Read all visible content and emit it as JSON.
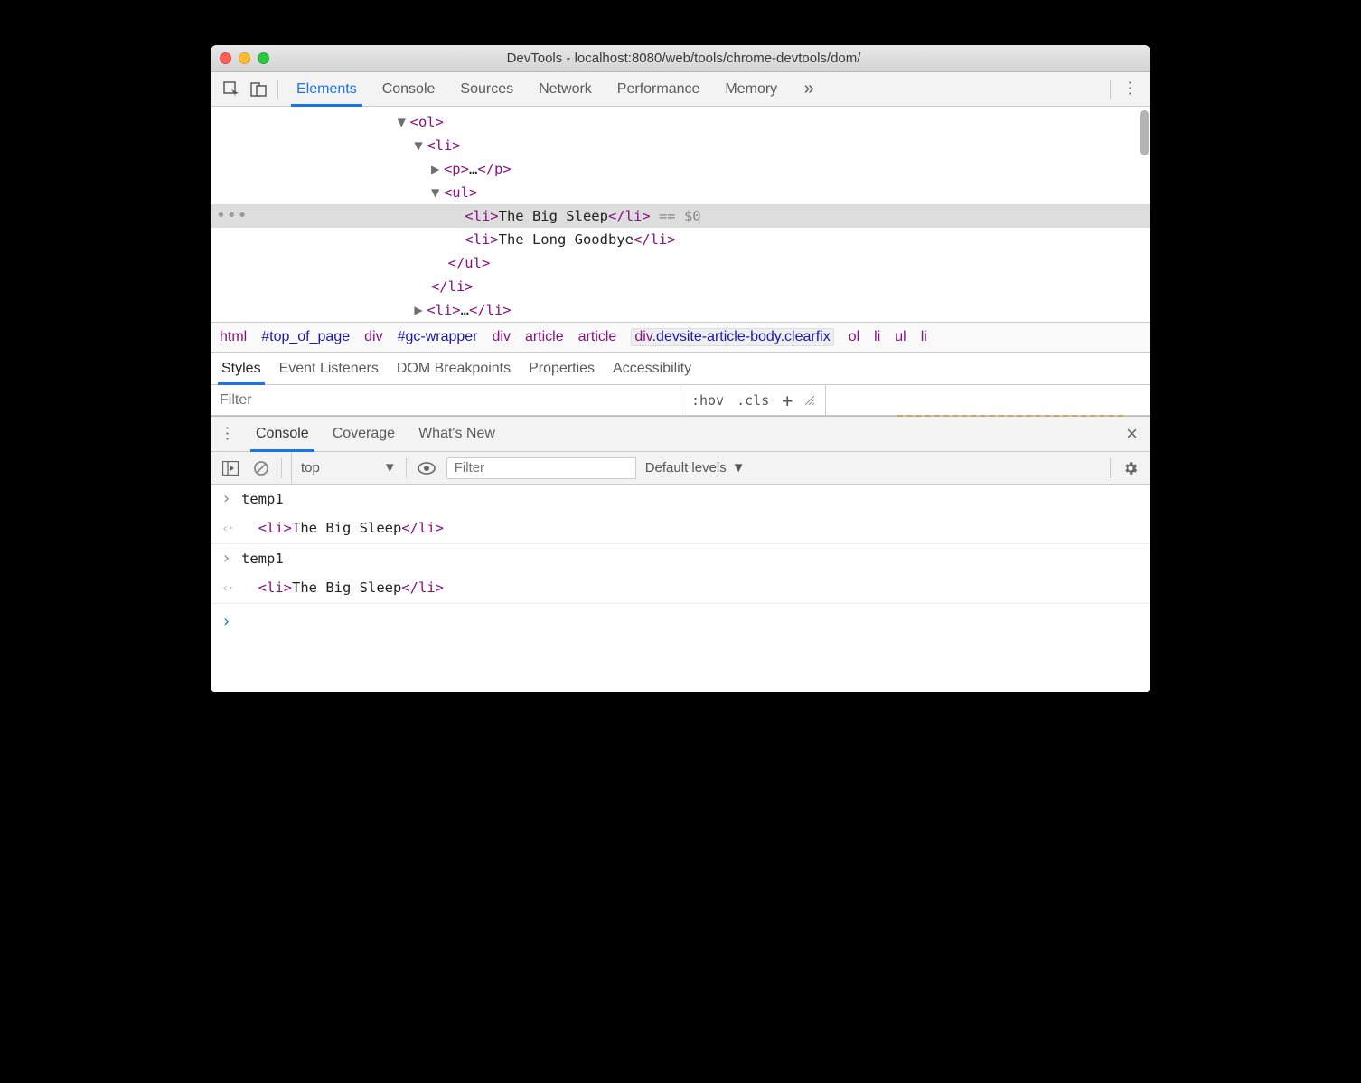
{
  "window": {
    "title": "DevTools - localhost:8080/web/tools/chrome-devtools/dom/"
  },
  "main_tabs": {
    "items": [
      "Elements",
      "Console",
      "Sources",
      "Network",
      "Performance",
      "Memory"
    ],
    "active": "Elements",
    "overflow_glyph": "»"
  },
  "dom": {
    "l0": "<ol>",
    "l1": "<li>",
    "l2_open": "<p>",
    "l2_ellipsis": "…",
    "l2_close": "</p>",
    "l3": "<ul>",
    "sel_open": "<li>",
    "sel_text": "The Big Sleep",
    "sel_close": "</li>",
    "sel_anno": " == $0",
    "sib_open": "<li>",
    "sib_text": "The Long Goodbye",
    "sib_close": "</li>",
    "close_ul": "</ul>",
    "close_li": "</li>",
    "last_open": "<li>",
    "last_ellipsis": "…",
    "last_close": "</li>"
  },
  "breadcrumbs": [
    {
      "tag": "html"
    },
    {
      "tag": "",
      "id": "#top_of_page"
    },
    {
      "tag": "div"
    },
    {
      "tag": "",
      "id": "#gc-wrapper"
    },
    {
      "tag": "div"
    },
    {
      "tag": "article"
    },
    {
      "tag": "article"
    },
    {
      "tag": "div",
      "cls": ".devsite-article-body.clearfix",
      "hl": true
    },
    {
      "tag": "ol"
    },
    {
      "tag": "li"
    },
    {
      "tag": "ul"
    },
    {
      "tag": "li"
    }
  ],
  "styles_tabs": [
    "Styles",
    "Event Listeners",
    "DOM Breakpoints",
    "Properties",
    "Accessibility"
  ],
  "styles_active": "Styles",
  "styles_bar": {
    "filter_placeholder": "Filter",
    "hov": ":hov",
    "cls": ".cls"
  },
  "drawer_tabs": [
    "Console",
    "Coverage",
    "What's New"
  ],
  "drawer_active": "Console",
  "console_toolbar": {
    "context": "top",
    "filter_placeholder": "Filter",
    "levels": "Default levels"
  },
  "console": {
    "entries": [
      {
        "in": "temp1",
        "out_open": "<li>",
        "out_text": "The Big Sleep",
        "out_close": "</li>"
      },
      {
        "in": "temp1",
        "out_open": "<li>",
        "out_text": "The Big Sleep",
        "out_close": "</li>"
      }
    ],
    "prompt": "›"
  }
}
